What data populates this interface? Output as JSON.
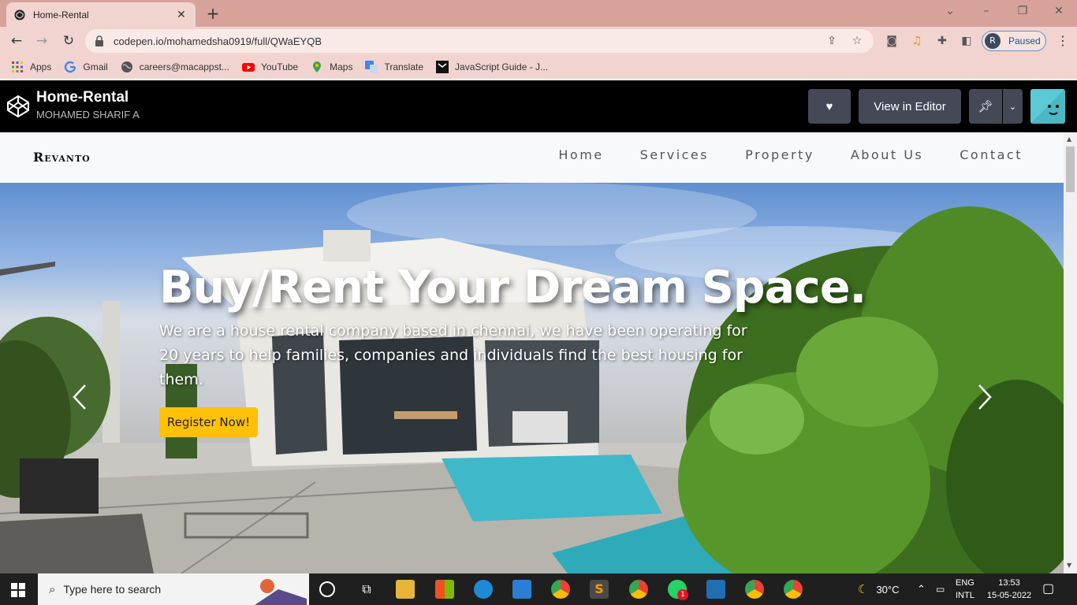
{
  "browser": {
    "tab_title": "Home-Rental",
    "new_tab_symbol": "+",
    "close_symbol": "✕",
    "url": "codepen.io/mohamedsha0919/full/QWaEYQB",
    "profile_initial": "R",
    "profile_status": "Paused",
    "bookmarks": [
      {
        "label": "Apps",
        "icon": "apps-grid-icon"
      },
      {
        "label": "Gmail",
        "icon": "google-icon"
      },
      {
        "label": "careers@macappst...",
        "icon": "globe-icon"
      },
      {
        "label": "YouTube",
        "icon": "youtube-icon"
      },
      {
        "label": "Maps",
        "icon": "maps-icon"
      },
      {
        "label": "Translate",
        "icon": "translate-icon"
      },
      {
        "label": "JavaScript Guide - J...",
        "icon": "bookmark-page-icon"
      }
    ]
  },
  "codepen": {
    "title": "Home-Rental",
    "author": "MOHAMED SHARIF A",
    "view_in_editor": "View in Editor"
  },
  "site": {
    "brand": "Revanto",
    "nav": [
      "Home",
      "Services",
      "Property",
      "About Us",
      "Contact"
    ],
    "hero": {
      "title": "Buy/Rent Your Dream Space.",
      "line1": "We are a house rental company based in chennai, we have been operating for",
      "line2": "20 years to help families, companies and individuals find the best housing for them.",
      "cta": "Register Now!"
    }
  },
  "taskbar": {
    "search_placeholder": "Type here to search",
    "weather": "30°C",
    "language": "ENG",
    "layout": "INTL",
    "time": "13:53",
    "date": "15-05-2022",
    "whatsapp_badge": "1"
  },
  "colors": {
    "tabstrip": "#d6a29a",
    "toolbar": "#f1d4cf",
    "codepen_bar": "#000000",
    "cta": "#ffc107"
  }
}
